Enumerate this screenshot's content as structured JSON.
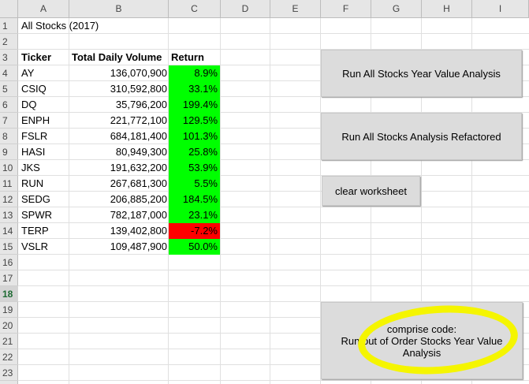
{
  "columns": [
    "A",
    "B",
    "C",
    "D",
    "E",
    "F",
    "G",
    "H",
    "I"
  ],
  "rows": [
    "1",
    "2",
    "3",
    "4",
    "5",
    "6",
    "7",
    "8",
    "9",
    "10",
    "11",
    "12",
    "13",
    "14",
    "15",
    "16",
    "17",
    "18",
    "19",
    "20",
    "21",
    "22",
    "23"
  ],
  "active_row": "18",
  "sheet_title": "All Stocks (2017)",
  "headers": {
    "ticker": "Ticker",
    "volume": "Total Daily Volume",
    "return": "Return"
  },
  "stocks": [
    {
      "ticker": "AY",
      "volume": "136,070,900",
      "return": "8.9%",
      "positive": true
    },
    {
      "ticker": "CSIQ",
      "volume": "310,592,800",
      "return": "33.1%",
      "positive": true
    },
    {
      "ticker": "DQ",
      "volume": "35,796,200",
      "return": "199.4%",
      "positive": true
    },
    {
      "ticker": "ENPH",
      "volume": "221,772,100",
      "return": "129.5%",
      "positive": true
    },
    {
      "ticker": "FSLR",
      "volume": "684,181,400",
      "return": "101.3%",
      "positive": true
    },
    {
      "ticker": "HASI",
      "volume": "80,949,300",
      "return": "25.8%",
      "positive": true
    },
    {
      "ticker": "JKS",
      "volume": "191,632,200",
      "return": "53.9%",
      "positive": true
    },
    {
      "ticker": "RUN",
      "volume": "267,681,300",
      "return": "5.5%",
      "positive": true
    },
    {
      "ticker": "SEDG",
      "volume": "206,885,200",
      "return": "184.5%",
      "positive": true
    },
    {
      "ticker": "SPWR",
      "volume": "782,187,000",
      "return": "23.1%",
      "positive": true
    },
    {
      "ticker": "TERP",
      "volume": "139,402,800",
      "return": "-7.2%",
      "positive": false
    },
    {
      "ticker": "VSLR",
      "volume": "109,487,900",
      "return": "50.0%",
      "positive": true
    }
  ],
  "buttons": {
    "run_all": "Run All Stocks Year Value Analysis",
    "refactored": "Run All Stocks Analysis Refactored",
    "clear": "clear worksheet",
    "compare_line1": "comprise code:",
    "compare_line2": "Run out of Order Stocks Year Value",
    "compare_line3": "Analysis"
  },
  "colors": {
    "positive": "#00ff00",
    "negative": "#ff0000",
    "highlight": "#f5f500"
  }
}
